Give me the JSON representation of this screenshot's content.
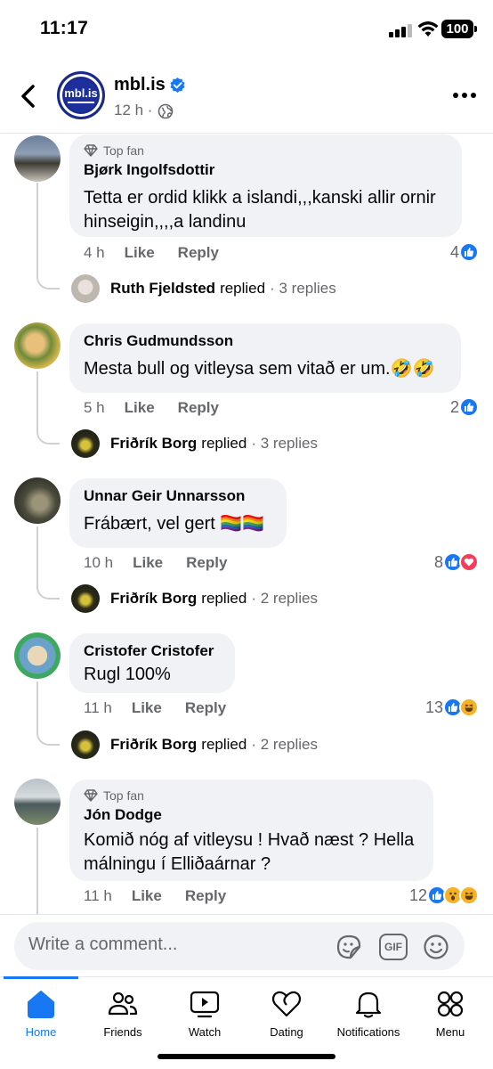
{
  "status": {
    "time": "11:17",
    "battery": "100"
  },
  "header": {
    "page_name": "mbl.is",
    "logo_text": "mbl.is",
    "time_ago": "12 h ·"
  },
  "comments": [
    {
      "top_fan": "Top fan",
      "author": "Bjørk Ingolfsdottir",
      "text": "Tetta er ordid klikk a islandi,,,kanski allir ornir hinseigin,,,,a landinu",
      "time": "4 h",
      "like": "Like",
      "reply": "Reply",
      "reaction_count": "4",
      "reactions": [
        "like"
      ],
      "reply_preview": {
        "name": "Ruth Fjeldsted",
        "verb": "replied",
        "count": "· 3 replies"
      }
    },
    {
      "author": "Chris Gudmundsson",
      "text": "Mesta bull og vitleysa sem vitað er um.🤣🤣",
      "time": "5 h",
      "like": "Like",
      "reply": "Reply",
      "reaction_count": "2",
      "reactions": [
        "like"
      ],
      "reply_preview": {
        "name": "Friðrík Borg",
        "verb": "replied",
        "count": "· 3 replies"
      }
    },
    {
      "author": "Unnar Geir Unnarsson",
      "text": "Frábært, vel gert 🏳️‍🌈🏳️‍🌈",
      "time": "10 h",
      "like": "Like",
      "reply": "Reply",
      "reaction_count": "8",
      "reactions": [
        "like",
        "love"
      ],
      "reply_preview": {
        "name": "Friðrík Borg",
        "verb": "replied",
        "count": "· 2 replies"
      }
    },
    {
      "author": "Cristofer Cristofer",
      "text": "Rugl 100%",
      "time": "11 h",
      "like": "Like",
      "reply": "Reply",
      "reaction_count": "13",
      "reactions": [
        "like",
        "haha"
      ],
      "reply_preview": {
        "name": "Friðrík Borg",
        "verb": "replied",
        "count": "· 2 replies"
      }
    },
    {
      "top_fan": "Top fan",
      "author": "Jón Dodge",
      "text": "Komið nóg af vitleysu ! Hvað næst ? Hella málningu í Elliðaárnar ?",
      "time": "11 h",
      "like": "Like",
      "reply": "Reply",
      "reaction_count": "12",
      "reactions": [
        "like",
        "wow",
        "haha"
      ]
    }
  ],
  "composer": {
    "placeholder": "Write a comment...",
    "gif": "GIF"
  },
  "tabs": [
    {
      "label": "Home",
      "icon": "home-icon",
      "active": true
    },
    {
      "label": "Friends",
      "icon": "friends-icon"
    },
    {
      "label": "Watch",
      "icon": "watch-icon"
    },
    {
      "label": "Dating",
      "icon": "dating-icon"
    },
    {
      "label": "Notifications",
      "icon": "bell-icon"
    },
    {
      "label": "Menu",
      "icon": "menu-grid-icon"
    }
  ],
  "colors": {
    "accent": "#1877f2",
    "bubble": "#f0f2f5",
    "secondary_text": "#65676b",
    "love": "#f33e58",
    "haha": "#f7b125"
  }
}
